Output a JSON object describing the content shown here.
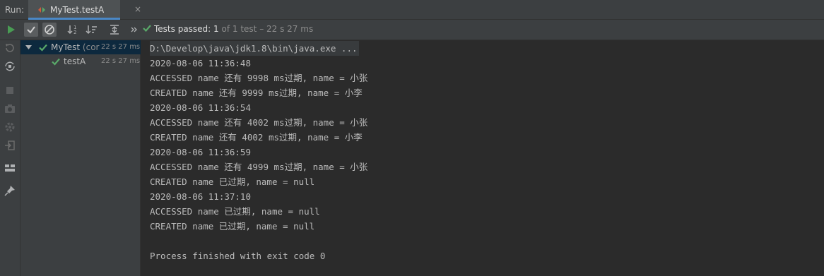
{
  "run_label": "Run:",
  "tab": {
    "title": "MyTest.testA",
    "close": "×"
  },
  "status": {
    "prefix": "Tests passed:",
    "count": "1",
    "detail": "of 1 test – 22 s 27 ms"
  },
  "tree": [
    {
      "name": "MyTest",
      "sub": "(cor",
      "time": "22 s 27 ms"
    },
    {
      "name": "testA",
      "time": "22 s 27 ms"
    }
  ],
  "console": [
    "D:\\Develop\\java\\jdk1.8\\bin\\java.exe ...",
    "2020-08-06 11:36:48",
    "ACCESSED name 还有 9998 ms过期, name = 小张",
    "CREATED name 还有 9999 ms过期, name = 小李",
    "2020-08-06 11:36:54",
    "ACCESSED name 还有 4002 ms过期, name = 小张",
    "CREATED name 还有 4002 ms过期, name = 小李",
    "2020-08-06 11:36:59",
    "ACCESSED name 还有 4999 ms过期, name = 小张",
    "CREATED name 已过期, name = null",
    "2020-08-06 11:37:10",
    "ACCESSED name 已过期, name = null",
    "CREATED name 已过期, name = null",
    "",
    "Process finished with exit code 0"
  ],
  "colors": {
    "accent": "#4a88c7",
    "pass": "#59a869",
    "run": "#499c54"
  }
}
